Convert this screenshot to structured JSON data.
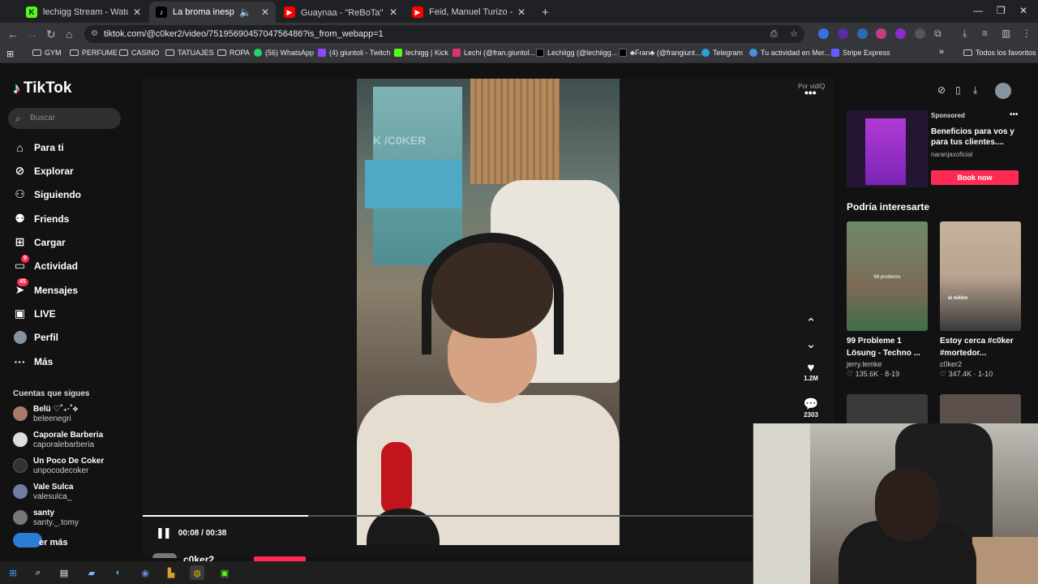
{
  "tabs": [
    {
      "label": "lechigg Stream - Watch Live on",
      "favicon": "kick-icon",
      "color": "#53fc18"
    },
    {
      "label": "La broma inesperada a Co",
      "favicon": "tiktok-icon",
      "color": "#000000",
      "active": true
    },
    {
      "label": "Guaynaa - \"ReBoTa\" 🍑 - YouTu",
      "favicon": "youtube-icon",
      "color": "#ff0000"
    },
    {
      "label": "Feid, Manuel Turizo - BORRAX",
      "favicon": "youtube-icon",
      "color": "#ff0000"
    }
  ],
  "new_tab": "+",
  "window_controls": {
    "minimize": "—",
    "restore": "❐",
    "close": "✕"
  },
  "address": {
    "url": "tiktok.com/@c0ker2/video/7519569045704756486?is_from_webapp=1"
  },
  "bookmarks": [
    {
      "label": "GYM",
      "type": "folder"
    },
    {
      "label": "PERFUME",
      "type": "folder"
    },
    {
      "label": "CASINO",
      "type": "folder"
    },
    {
      "label": "TATUAJES",
      "type": "folder"
    },
    {
      "label": "ROPA",
      "type": "folder"
    },
    {
      "label": "(56) WhatsApp",
      "type": "site",
      "color": "#25d366"
    },
    {
      "label": "(4) giuntoli - Twitch",
      "type": "site",
      "color": "#9146ff"
    },
    {
      "label": "lechigg | Kick",
      "type": "site",
      "color": "#53fc18"
    },
    {
      "label": "Lechi (@fran.giuntol...",
      "type": "site",
      "color": "#e1306c"
    },
    {
      "label": "Lechiigg (@lechiigg...",
      "type": "site",
      "color": "#000000"
    },
    {
      "label": "♣Fran♣ (@frangiunt...",
      "type": "site",
      "color": "#000000"
    },
    {
      "label": "Telegram",
      "type": "site",
      "color": "#2aa1da"
    },
    {
      "label": "Tu actividad en Mer...",
      "type": "site",
      "color": "#4a90e2"
    },
    {
      "label": "Stripe Express",
      "type": "site",
      "color": "#635bff"
    }
  ],
  "bookmarks_overflow": "»",
  "bookmarks_all": "Todos los favoritos",
  "tiktok": {
    "logo": "TikTok",
    "search_placeholder": "Buscar",
    "nav": [
      {
        "label": "Para ti",
        "icon": "home-icon"
      },
      {
        "label": "Explorar",
        "icon": "compass-icon"
      },
      {
        "label": "Siguiendo",
        "icon": "following-icon"
      },
      {
        "label": "Friends",
        "icon": "friends-icon"
      },
      {
        "label": "Cargar",
        "icon": "upload-icon"
      },
      {
        "label": "Actividad",
        "icon": "activity-icon",
        "badge": "9"
      },
      {
        "label": "Mensajes",
        "icon": "messages-icon",
        "badge": "45"
      },
      {
        "label": "LIVE",
        "icon": "live-icon"
      },
      {
        "label": "Perfil",
        "icon": "profile-avatar"
      },
      {
        "label": "Más",
        "icon": "more-icon"
      }
    ],
    "following_header": "Cuentas que sigues",
    "following": [
      {
        "name": "Belü ♡˚₊·˚⟡",
        "handle": "beleenegri"
      },
      {
        "name": "Caporale Barberia",
        "handle": "caporalebarberia"
      },
      {
        "name": "Un Poco De Coker",
        "handle": "unpocodecoker"
      },
      {
        "name": "Vale Sulca",
        "handle": "valesulca_"
      },
      {
        "name": "santy",
        "handle": "santy._.tomy"
      }
    ],
    "see_more": "er más",
    "player": {
      "watermark": "K /C0KER",
      "time": "00:08 / 00:38",
      "progress": 0.24,
      "por_vidiq": "Por vidIQ",
      "more": "•••",
      "likes": "1.2M",
      "comments": "2303",
      "username": "c0ker2"
    },
    "ad": {
      "sponsored": "Sponsored",
      "title": "Beneficios para vos y para tus clientes....",
      "source": "naranjaxoficial",
      "button": "Book now",
      "more": "•••"
    },
    "recommended_header": "Podría interesarte",
    "recommended": [
      {
        "title": "99 Probleme 1 Lösung - Techno ...",
        "author": "jerry.lemke",
        "stats": "♡ 135.6K · 8-19",
        "overlay": "99 problems"
      },
      {
        "title": "Estoy cerca #c0ker #mortedor...",
        "author": "c0ker2",
        "stats": "♡ 347.4K · 1-10",
        "overlay": "el millon"
      }
    ]
  },
  "colors": {
    "accent": "#fe2c55",
    "bg": "#121212"
  }
}
